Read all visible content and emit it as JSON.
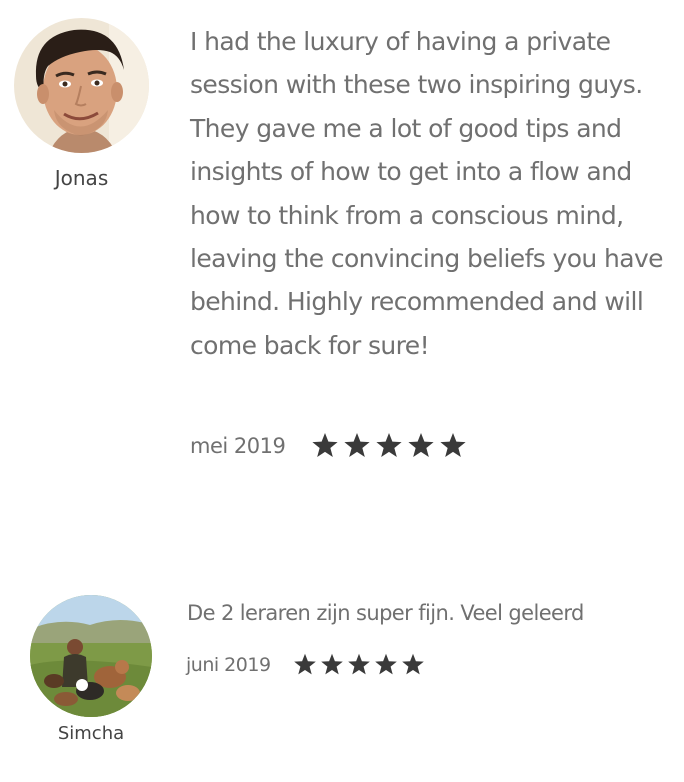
{
  "reviews": [
    {
      "name": "Jonas",
      "text": "I had the luxury of having a private session with these two inspiring guys. They gave me a lot of good tips and insights of how to get into a flow and how to think from a conscious mind, leaving the convincing beliefs you have behind. Highly recommended and will come back for sure!",
      "date": "mei 2019",
      "rating": 5,
      "avatar_icon": "portrait-photo"
    },
    {
      "name": "Simcha",
      "text": "De 2 leraren zijn super fijn. Veel geleerd",
      "date": "juni 2019",
      "rating": 5,
      "avatar_icon": "landscape-photo-with-dogs"
    }
  ],
  "colors": {
    "text": "#707070",
    "name": "#444444",
    "star": "#3a3a3a",
    "background": "#ffffff"
  }
}
